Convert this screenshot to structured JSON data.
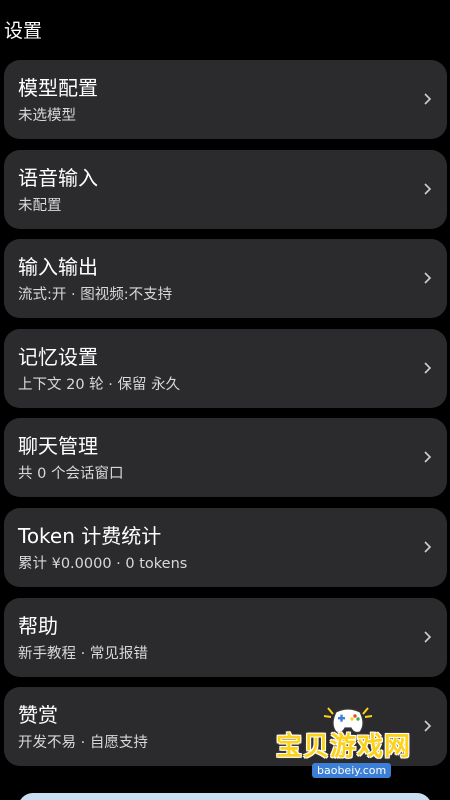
{
  "header": {
    "title": "设置"
  },
  "settings": [
    {
      "title": "模型配置",
      "subtitle": "未选模型"
    },
    {
      "title": "语音输入",
      "subtitle": "未配置"
    },
    {
      "title": "输入输出",
      "subtitle": "流式:开 · 图视频:不支持"
    },
    {
      "title": "记忆设置",
      "subtitle": "上下文 20 轮 · 保留 永久"
    },
    {
      "title": "聊天管理",
      "subtitle": "共 0 个会话窗口"
    },
    {
      "title": "Token 计费统计",
      "subtitle": "累计 ¥0.0000 · 0 tokens"
    },
    {
      "title": "帮助",
      "subtitle": "新手教程 · 常见报错"
    },
    {
      "title": "赞赏",
      "subtitle": "开发不易 · 自愿支持"
    }
  ],
  "watermark": {
    "name": "宝贝游戏网",
    "url": "baobeiy.com"
  },
  "colors": {
    "background": "#000000",
    "card": "#2b2b2e",
    "text": "#ffffff",
    "subtext": "#d8d8d8",
    "chevron": "#cfcfcf"
  },
  "icons": {
    "row_chevron": "chevron-right-icon"
  }
}
